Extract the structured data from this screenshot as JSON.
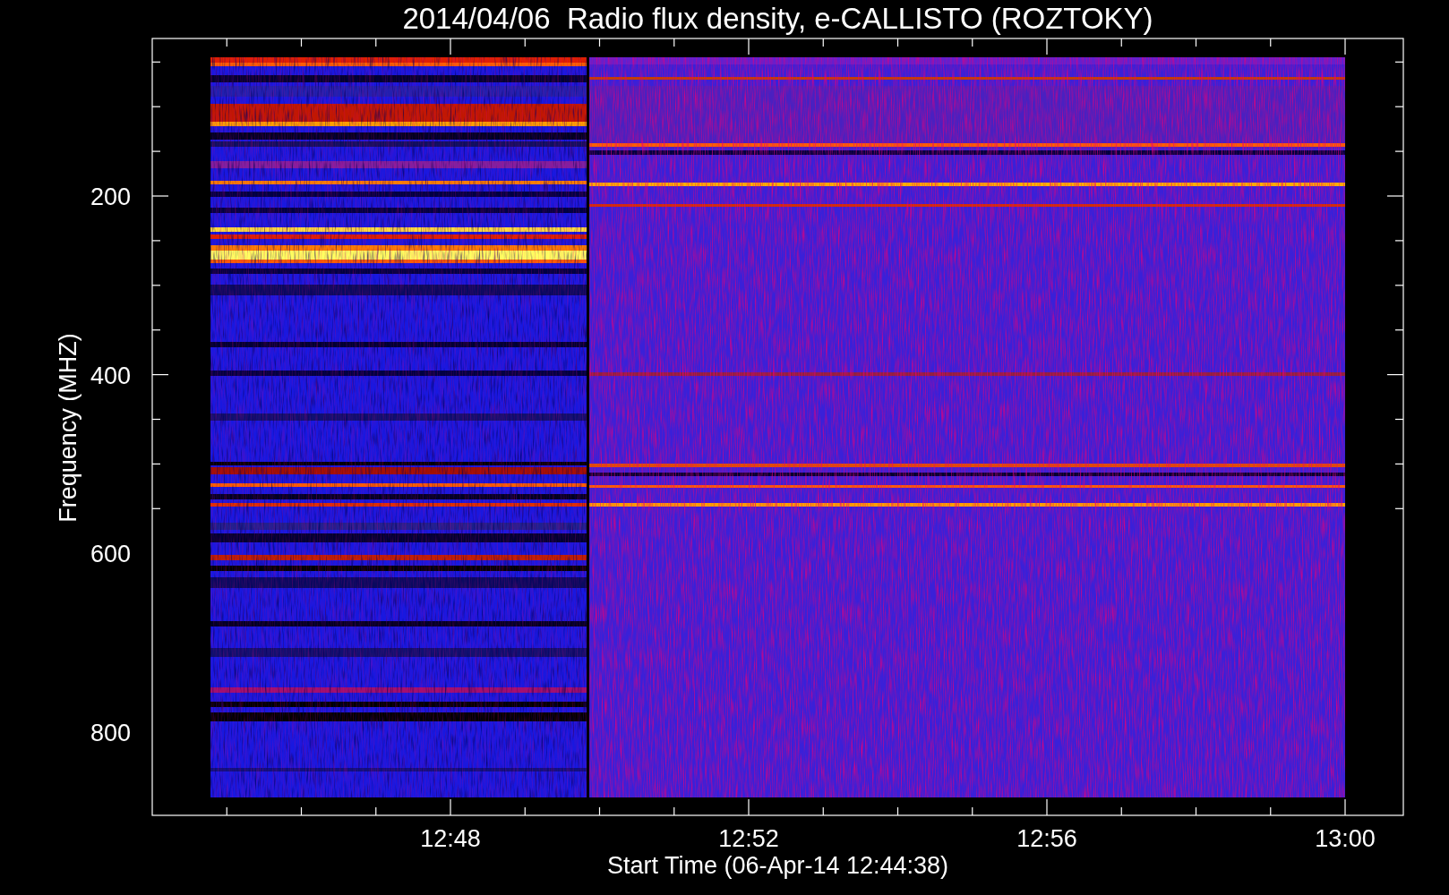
{
  "title": "2014/04/06  Radio flux density, e-CALLISTO (ROZTOKY)",
  "plot": {
    "ylabel": "Frequency (MHZ)",
    "xlabel": "Start Time (06-Apr-14 12:44:38)",
    "yticks": [
      "200",
      "400",
      "600",
      "800"
    ],
    "xticks": [
      "12:48",
      "12:52",
      "12:56",
      "13:00"
    ]
  }
}
